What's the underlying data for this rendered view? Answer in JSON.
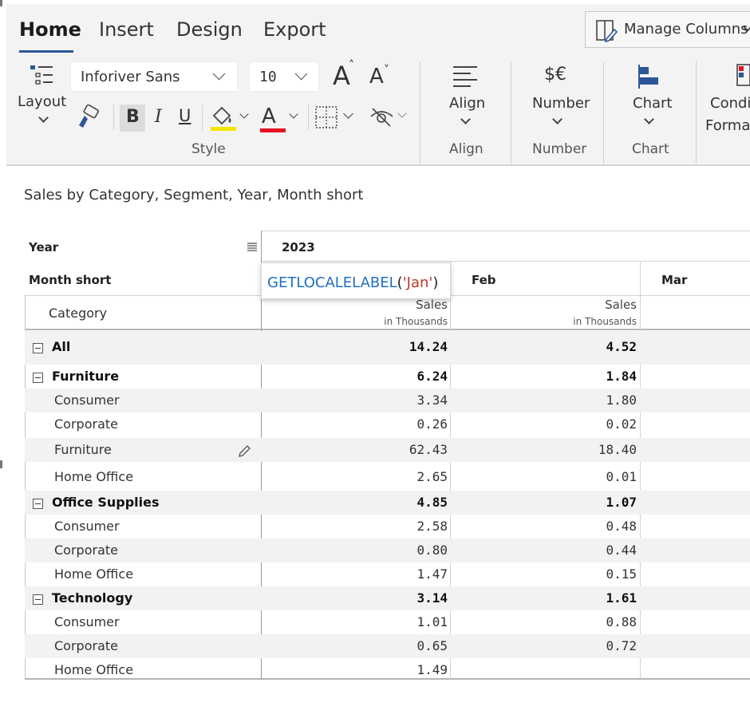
{
  "ribbon": {
    "tabs": [
      "Home",
      "Insert",
      "Design",
      "Export"
    ],
    "active_tab": "Home",
    "manage_columns_label": "Manage Columns",
    "layout_label": "Layout",
    "font_name": "Inforiver Sans",
    "font_size": "10",
    "style_group_label": "Style",
    "align_label": "Align",
    "align_group_label": "Align",
    "number_icon": "$€",
    "number_label": "Number",
    "number_group_label": "Number",
    "chart_label": "Chart",
    "chart_group_label": "Chart",
    "cond_format_label_1": "Condi",
    "cond_format_label_2": "Format",
    "bold_glyph": "B",
    "italic_glyph": "I",
    "underline_glyph": "U",
    "font_color_glyph": "A",
    "grow_font_glyph": "A",
    "shrink_font_glyph": "A",
    "accent_color": "#2b579a",
    "highlight_color": "#f5e600",
    "font_color": "#e81123"
  },
  "report": {
    "title": "Sales by Category, Segment, Year, Month short",
    "year_header": "Year",
    "year_value": "2023",
    "month_header": "Month short",
    "category_header": "Category",
    "months": [
      "Jan",
      "Feb",
      "Mar"
    ],
    "formula": {
      "fn": "GETLOCALELABEL",
      "open": "(",
      "arg": "'Jan'",
      "close": ")"
    },
    "measure_label": "Sales",
    "measure_unit": "in Thousands",
    "rows": [
      {
        "label": "All",
        "level": 0,
        "bold": true,
        "expander": true,
        "jan": "14.24",
        "feb": "4.52"
      },
      {
        "label": "Furniture",
        "level": 0,
        "bold": true,
        "expander": true,
        "jan": "6.24",
        "feb": "1.84"
      },
      {
        "label": "Consumer",
        "level": 1,
        "bold": false,
        "jan": "3.34",
        "feb": "1.80"
      },
      {
        "label": "Corporate",
        "level": 1,
        "bold": false,
        "jan": "0.26",
        "feb": "0.02"
      },
      {
        "label": "Furniture",
        "level": 1,
        "bold": false,
        "edit": true,
        "jan": "62.43",
        "feb": "18.40"
      },
      {
        "label": "Home Office",
        "level": 1,
        "bold": false,
        "jan": "2.65",
        "feb": "0.01"
      },
      {
        "label": "Office Supplies",
        "level": 0,
        "bold": true,
        "expander": true,
        "jan": "4.85",
        "feb": "1.07"
      },
      {
        "label": "Consumer",
        "level": 1,
        "bold": false,
        "jan": "2.58",
        "feb": "0.48"
      },
      {
        "label": "Corporate",
        "level": 1,
        "bold": false,
        "jan": "0.80",
        "feb": "0.44"
      },
      {
        "label": "Home Office",
        "level": 1,
        "bold": false,
        "jan": "1.47",
        "feb": "0.15"
      },
      {
        "label": "Technology",
        "level": 0,
        "bold": true,
        "expander": true,
        "jan": "3.14",
        "feb": "1.61"
      },
      {
        "label": "Consumer",
        "level": 1,
        "bold": false,
        "jan": "1.01",
        "feb": "0.88"
      },
      {
        "label": "Corporate",
        "level": 1,
        "bold": false,
        "jan": "0.65",
        "feb": "0.72"
      },
      {
        "label": "Home Office",
        "level": 1,
        "bold": false,
        "jan": "1.49",
        "feb": ""
      }
    ]
  }
}
